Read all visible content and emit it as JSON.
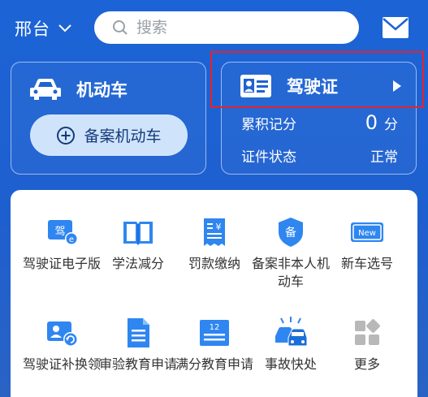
{
  "header": {
    "city": "邢台",
    "search_placeholder": "搜索",
    "icons": {
      "chevron": "chevron-down-icon",
      "search": "search-icon",
      "mail": "mail-icon"
    }
  },
  "vehicle_card": {
    "title": "机动车",
    "register_button": "备案机动车"
  },
  "license_card": {
    "title": "驾驶证",
    "points_label": "累积记分",
    "points_value": "0",
    "points_unit": "分",
    "status_label": "证件状态",
    "status_value": "正常"
  },
  "services": [
    {
      "label": "驾驶证电子版",
      "icon": "e-license-icon"
    },
    {
      "label": "学法减分",
      "icon": "book-icon"
    },
    {
      "label": "罚款缴纳",
      "icon": "fine-bill-icon"
    },
    {
      "label": "备案非本人机动车",
      "icon": "register-shield-icon"
    },
    {
      "label": "新车选号",
      "icon": "new-plate-icon"
    },
    {
      "label": "驾驶证补换领",
      "icon": "license-renew-icon"
    },
    {
      "label": "审验教育申请",
      "icon": "document-icon"
    },
    {
      "label": "满分教育申请",
      "icon": "full-score-icon"
    },
    {
      "label": "事故快处",
      "icon": "accident-icon"
    },
    {
      "label": "更多",
      "icon": "more-grid-icon"
    }
  ],
  "colors": {
    "primary_blue": "#1e62d3",
    "icon_blue": "#2f86f0",
    "highlight_red": "#e8222a",
    "button_bg": "#cfe4fb"
  }
}
